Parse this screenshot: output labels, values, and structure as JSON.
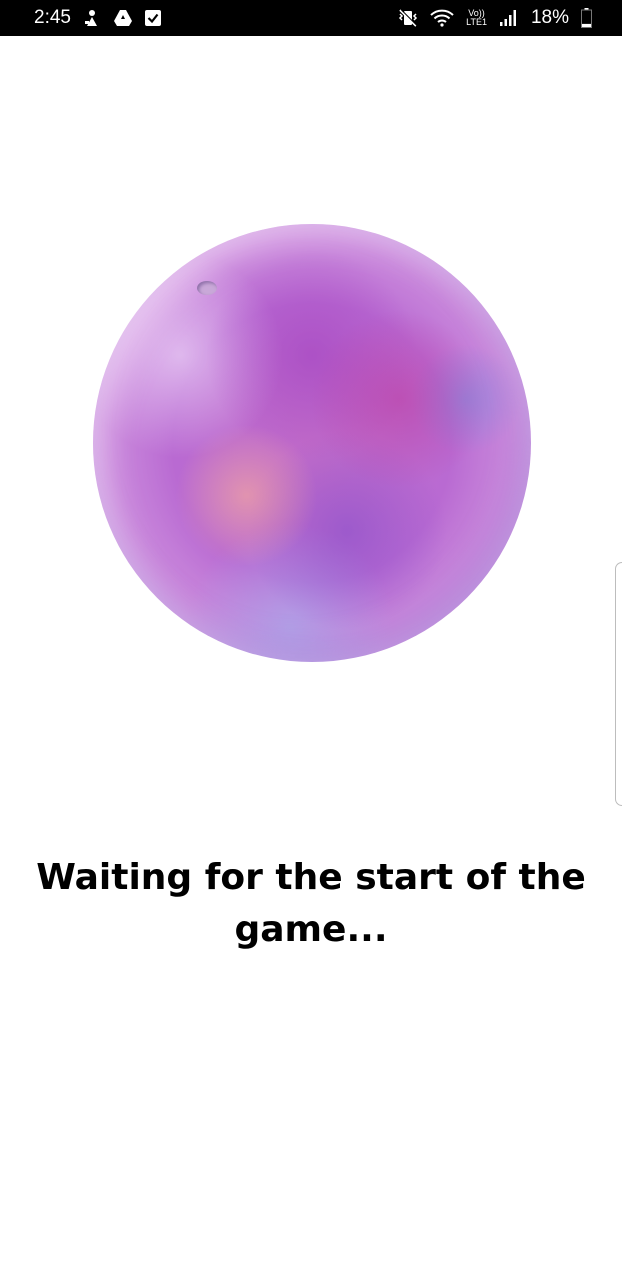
{
  "status_bar": {
    "time": "2:45",
    "left_icons": [
      "person-download-icon",
      "drive-icon",
      "checkbox-notification-icon"
    ],
    "right_icons": [
      "mute-vibrate-icon",
      "wifi-icon",
      "volte-lte-icon",
      "signal-icon",
      "battery-icon"
    ],
    "volte_label": "Vo))",
    "lte_label": "LTE1",
    "battery_percent": "18%",
    "battery_level": 0.18
  },
  "main": {
    "image": "planet-image",
    "status_text": "Waiting for the start of the game..."
  },
  "colors": {
    "status_bar_bg": "#000000",
    "background": "#ffffff",
    "text": "#000000",
    "planet_primary": "#b96ad2"
  }
}
